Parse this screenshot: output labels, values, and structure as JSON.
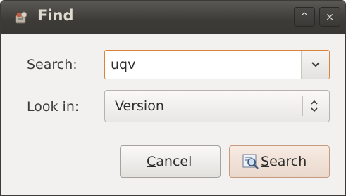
{
  "window": {
    "title": "Find",
    "maximize_glyph": "^",
    "close_glyph": "×"
  },
  "form": {
    "search_label": "Search:",
    "search_value": "uqv",
    "look_in_label": "Look in:",
    "look_in_value": "Version"
  },
  "buttons": {
    "cancel_mnemonic": "C",
    "cancel_rest": "ancel",
    "search_mnemonic": "S",
    "search_rest": "earch"
  },
  "icons": {
    "app": "find-app-icon",
    "dropdown": "chevron-down-icon",
    "updown": "up-down-arrows-icon",
    "search": "magnifier-icon"
  },
  "colors": {
    "titlebar": "#3c3b37",
    "focus_border": "#d9833b",
    "dialog_bg": "#f2f1f0"
  }
}
